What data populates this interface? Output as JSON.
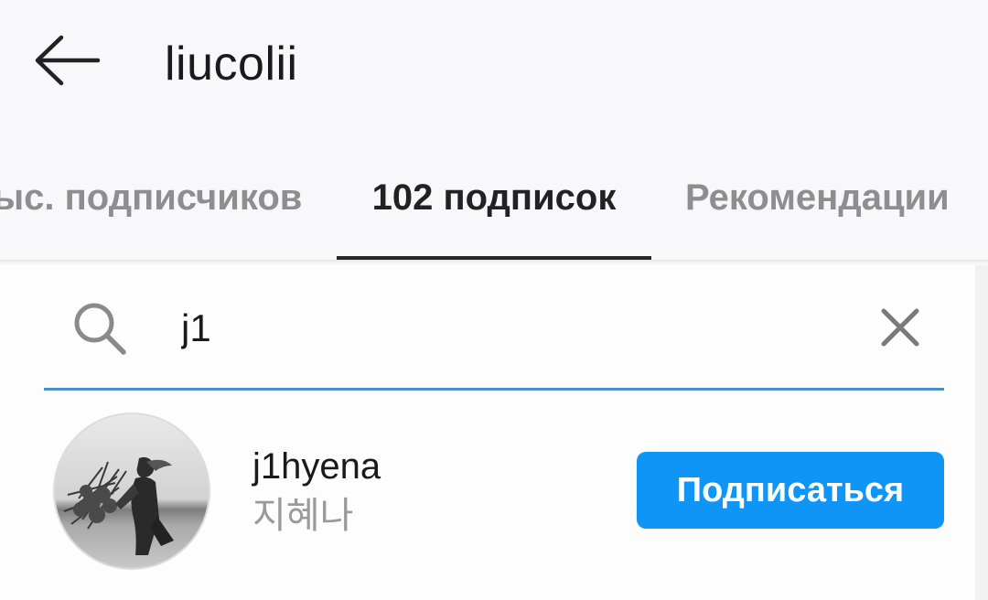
{
  "header": {
    "back_icon": "arrow-left-icon",
    "title": "liucolii"
  },
  "tabs": [
    {
      "label": "ыс. подписчиков",
      "active": false
    },
    {
      "label": "102 подписок",
      "active": true
    },
    {
      "label": "Рекомендации",
      "active": false
    }
  ],
  "search": {
    "icon": "search-icon",
    "value": "j1",
    "clear_icon": "close-icon",
    "underline_color": "#4a8fca"
  },
  "results": [
    {
      "username": "j1hyena",
      "full_name": "지혜나",
      "avatar": "photo-avatar",
      "follow_label": "Подписаться"
    }
  ],
  "colors": {
    "accent": "#0e95f6",
    "text_primary": "#1a1a1a",
    "text_secondary": "#8e8e8e",
    "header_bg": "#f8f7f9"
  }
}
